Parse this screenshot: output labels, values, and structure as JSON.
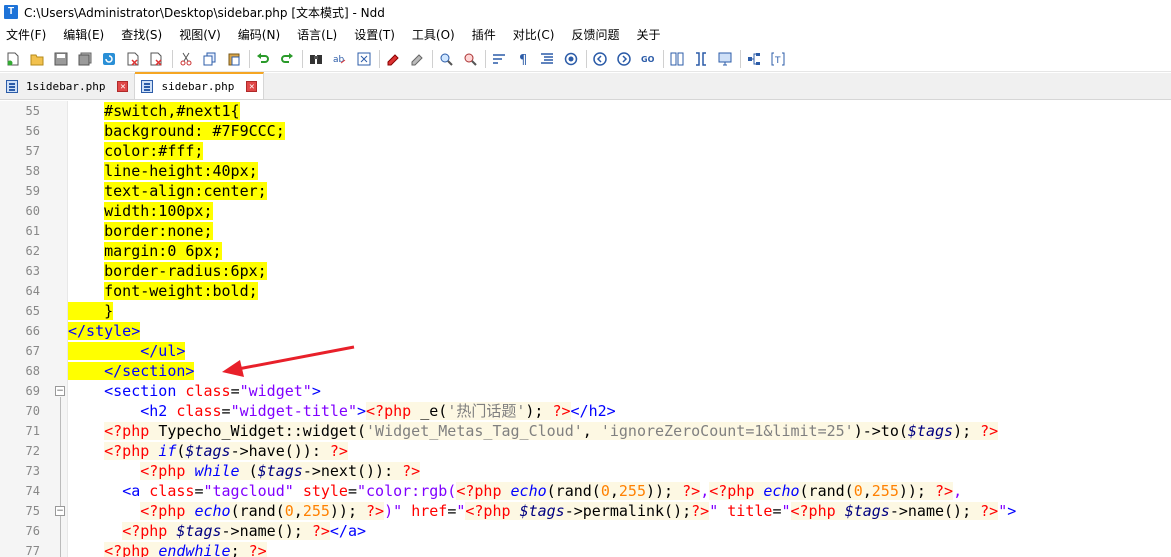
{
  "window": {
    "title": "C:\\Users\\Administrator\\Desktop\\sidebar.php [文本模式] - Ndd",
    "app_icon_letter": "T"
  },
  "menu": [
    "文件(F)",
    "编辑(E)",
    "查找(S)",
    "视图(V)",
    "编码(N)",
    "语言(L)",
    "设置(T)",
    "工具(O)",
    "插件",
    "对比(C)",
    "反馈问题",
    "关于"
  ],
  "toolbar": {
    "icons": [
      "new-file-icon",
      "open-file-icon",
      "save-icon",
      "save-all-icon",
      "reload-icon",
      "close-icon",
      "close-all-icon",
      "cut-icon",
      "copy-icon",
      "paste-icon",
      "undo-icon",
      "redo-icon",
      "find-icon",
      "replace-icon",
      "goto-icon",
      "mark-icon",
      "clear-mark-icon",
      "zoom-in-icon",
      "zoom-out-icon",
      "word-wrap-icon",
      "show-symbols-icon",
      "indent-guide-icon",
      "macro-record-icon",
      "prev-icon",
      "next-icon",
      "goto-line-icon",
      "compare-icon",
      "binary-compare-icon",
      "monitor-icon",
      "tree-icon",
      "text-mode-icon"
    ]
  },
  "tabs": [
    {
      "label": "1sidebar.php",
      "active": false
    },
    {
      "label": "sidebar.php",
      "active": true
    }
  ],
  "editor": {
    "line_numbers": [
      "55",
      "56",
      "57",
      "58",
      "59",
      "60",
      "61",
      "62",
      "63",
      "64",
      "65",
      "66",
      "67",
      "68",
      "69",
      "70",
      "71",
      "72",
      "73",
      "74",
      "75",
      "76",
      "77"
    ]
  },
  "colors": {
    "highlight": "#ffff00",
    "arrow": "#e8202a",
    "active_tab_accent": "#f5a623"
  }
}
